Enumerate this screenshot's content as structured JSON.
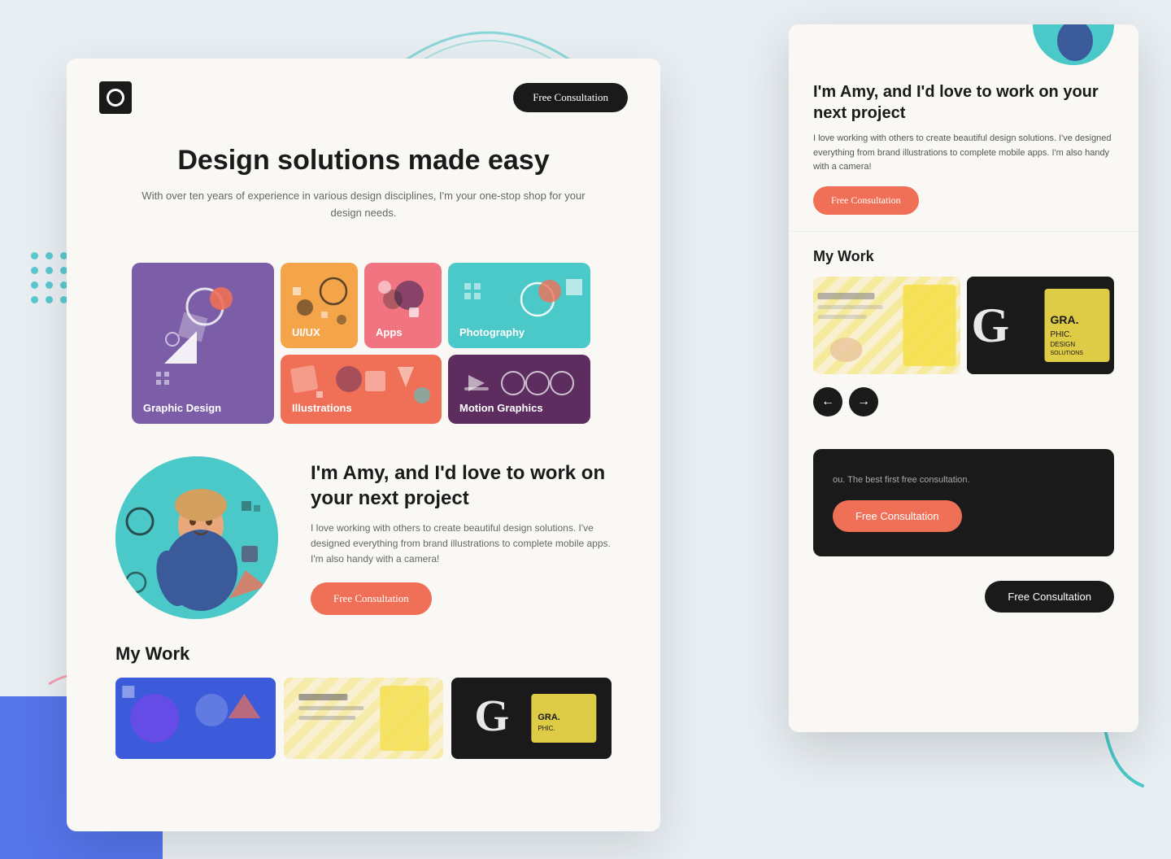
{
  "background": {
    "color": "#e8eef2"
  },
  "card_main": {
    "header": {
      "consultation_btn": "Free Consultation"
    },
    "hero": {
      "title": "Design solutions made easy",
      "subtitle": "With over ten years of experience in various design disciplines, I'm your one-stop shop for your design needs."
    },
    "services": [
      {
        "id": "graphic-design",
        "label": "Graphic Design",
        "color": "#7b5ea7"
      },
      {
        "id": "ui-ux",
        "label": "UI/UX",
        "color": "#f4a54a"
      },
      {
        "id": "apps",
        "label": "Apps",
        "color": "#f07580"
      },
      {
        "id": "photography",
        "label": "Photography",
        "color": "#4bc8c8"
      },
      {
        "id": "illustrations",
        "label": "Illustrations",
        "color": "#f07057"
      },
      {
        "id": "motion-graphics",
        "label": "Motion Graphics",
        "color": "#5c2d5e"
      }
    ],
    "about": {
      "title": "I'm Amy, and I'd love to work on your next project",
      "description": "I love working with others to create beautiful design solutions. I've designed everything from brand illustrations to complete mobile apps. I'm also handy with a camera!",
      "cta_btn": "Free Consultation"
    },
    "work": {
      "section_title": "My Work"
    }
  },
  "card_secondary": {
    "header_avatar_visible": true,
    "about": {
      "title": "I'm Amy, and I'd love to work on your next project",
      "description": "I love working with others to create beautiful design solutions. I've designed everything from brand illustrations to complete mobile apps. I'm also handy with a camera!",
      "cta_btn": "Free Consultation"
    },
    "work": {
      "section_title": "My Work",
      "carousel_prev": "←",
      "carousel_next": "→"
    },
    "cta": {
      "text": "ou. The best first free consultation.",
      "btn": "Free Consultation"
    },
    "footer_btn": "Free Consultation"
  }
}
